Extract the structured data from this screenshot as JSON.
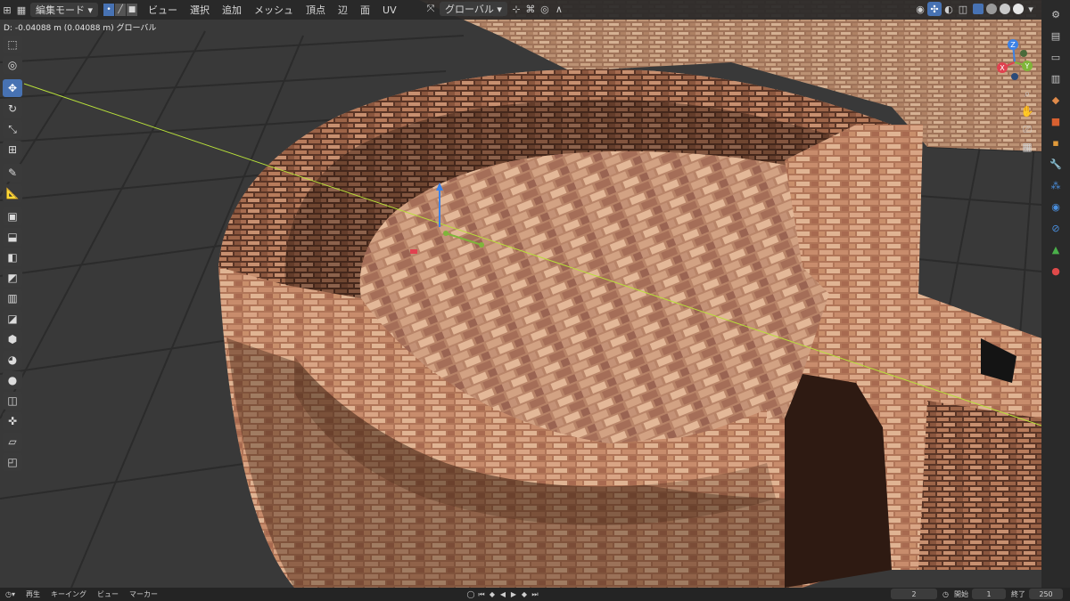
{
  "header": {
    "mode_label": "編集モード",
    "menu": [
      "ビュー",
      "選択",
      "追加",
      "メッシュ",
      "頂点",
      "辺",
      "面",
      "UV"
    ],
    "transform_orientation": "グローバル"
  },
  "status": {
    "operation_text": "D: -0.04088 m (0.04088 m) グローバル"
  },
  "toolbar": {
    "tools": [
      {
        "name": "select-box-tool",
        "glyph": "⬚",
        "active": false
      },
      {
        "name": "cursor-tool",
        "glyph": "◎",
        "active": false
      },
      {
        "name": "move-tool",
        "glyph": "✥",
        "active": true
      },
      {
        "name": "rotate-tool",
        "glyph": "↻",
        "active": false
      },
      {
        "name": "scale-tool",
        "glyph": "⤡",
        "active": false
      },
      {
        "name": "transform-tool",
        "glyph": "⊞",
        "active": false
      },
      {
        "name": "annotate-tool",
        "glyph": "✎",
        "active": false
      },
      {
        "name": "measure-tool",
        "glyph": "📐",
        "active": false
      },
      {
        "name": "add-cube-tool",
        "glyph": "▣",
        "active": false
      },
      {
        "name": "extrude-tool",
        "glyph": "⬓",
        "active": false
      },
      {
        "name": "inset-tool",
        "glyph": "◧",
        "active": false
      },
      {
        "name": "bevel-tool",
        "glyph": "◩",
        "active": false
      },
      {
        "name": "loop-cut-tool",
        "glyph": "▥",
        "active": false
      },
      {
        "name": "knife-tool",
        "glyph": "◪",
        "active": false
      },
      {
        "name": "poly-build-tool",
        "glyph": "⬢",
        "active": false
      },
      {
        "name": "spin-tool",
        "glyph": "◕",
        "active": false
      },
      {
        "name": "smooth-tool",
        "glyph": "●",
        "active": false
      },
      {
        "name": "edge-slide-tool",
        "glyph": "◫",
        "active": false
      },
      {
        "name": "shrink-fatten-tool",
        "glyph": "✜",
        "active": false
      },
      {
        "name": "shear-tool",
        "glyph": "▱",
        "active": false
      },
      {
        "name": "rip-tool",
        "glyph": "◰",
        "active": false
      }
    ]
  },
  "gizmo": {
    "x": "X",
    "y": "Y",
    "z": "Z"
  },
  "timeline": {
    "playback_label": "再生",
    "keying_label": "キーイング",
    "view_label": "ビュー",
    "marker_label": "マーカー",
    "current_frame": "2",
    "start_label": "開始",
    "start_frame": "1",
    "end_label": "終了",
    "end_frame": "250"
  },
  "colors": {
    "accent": "#4772b3",
    "axis_x": "#e0414f",
    "axis_y": "#7fb53a",
    "axis_z": "#3c82e6",
    "guide_line": "#b8e03a"
  }
}
